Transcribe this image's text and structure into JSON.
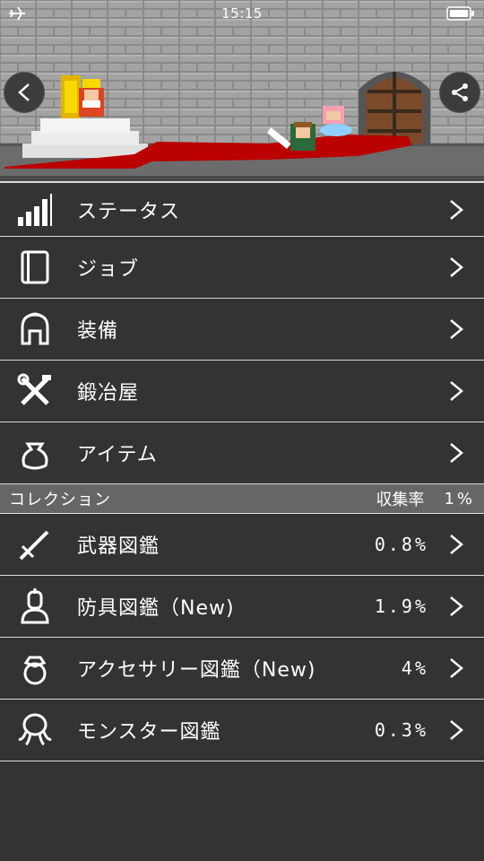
{
  "status": {
    "time": "15:15"
  },
  "menu": [
    {
      "label": "ステータス",
      "icon": "signal-bars-icon"
    },
    {
      "label": "ジョブ",
      "icon": "book-icon"
    },
    {
      "label": "装備",
      "icon": "helmet-icon"
    },
    {
      "label": "鍛冶屋",
      "icon": "tools-icon"
    },
    {
      "label": "アイテム",
      "icon": "bag-icon"
    }
  ],
  "collection": {
    "title": "コレクション",
    "rate_label": "収集率",
    "rate_value": "1%",
    "items": [
      {
        "label": "武器図鑑",
        "value": "0.8%",
        "icon": "sword-icon"
      },
      {
        "label": "防具図鑑（New)",
        "value": "1.9%",
        "icon": "knight-bust-icon"
      },
      {
        "label": "アクセサリー図鑑（New)",
        "value": "4%",
        "icon": "ring-icon"
      },
      {
        "label": "モンスター図鑑",
        "value": "0.3%",
        "icon": "octopus-icon"
      }
    ]
  }
}
